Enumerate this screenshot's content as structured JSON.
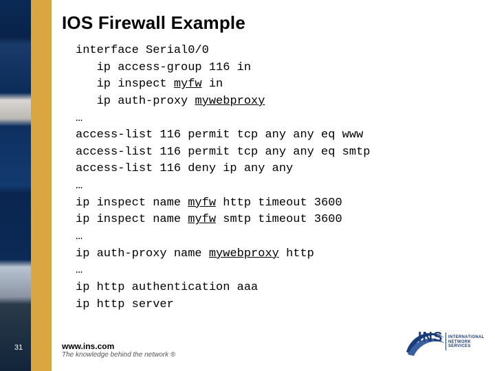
{
  "title": "IOS Firewall Example",
  "page_number": "31",
  "footer": {
    "url": "www.ins.com",
    "tagline": "The knowledge behind the network ®"
  },
  "logo": {
    "main": "INS",
    "sub_line1": "INTERNATIONAL",
    "sub_line2": "NETWORK SERVICES"
  },
  "code": {
    "l01a": "interface Serial0/0",
    "l02a": "   ip access-group 116 in",
    "l03a": "   ip inspect ",
    "l03u": "myfw",
    "l03b": " in",
    "l04a": "   ip auth-proxy ",
    "l04u": "mywebproxy",
    "l05a": "…",
    "l06a": "access-list 116 permit tcp any any eq www",
    "l07a": "access-list 116 permit tcp any any eq smtp",
    "l08a": "access-list 116 deny ip any any",
    "l09a": "…",
    "l10a": "ip inspect name ",
    "l10u": "myfw",
    "l10b": " http timeout 3600",
    "l11a": "ip inspect name ",
    "l11u": "myfw",
    "l11b": " smtp timeout 3600",
    "l12a": "…",
    "l13a": "ip auth-proxy name ",
    "l13u": "mywebproxy",
    "l13b": " http",
    "l14a": "…",
    "l15a": "ip http authentication aaa",
    "l16a": "ip http server"
  }
}
